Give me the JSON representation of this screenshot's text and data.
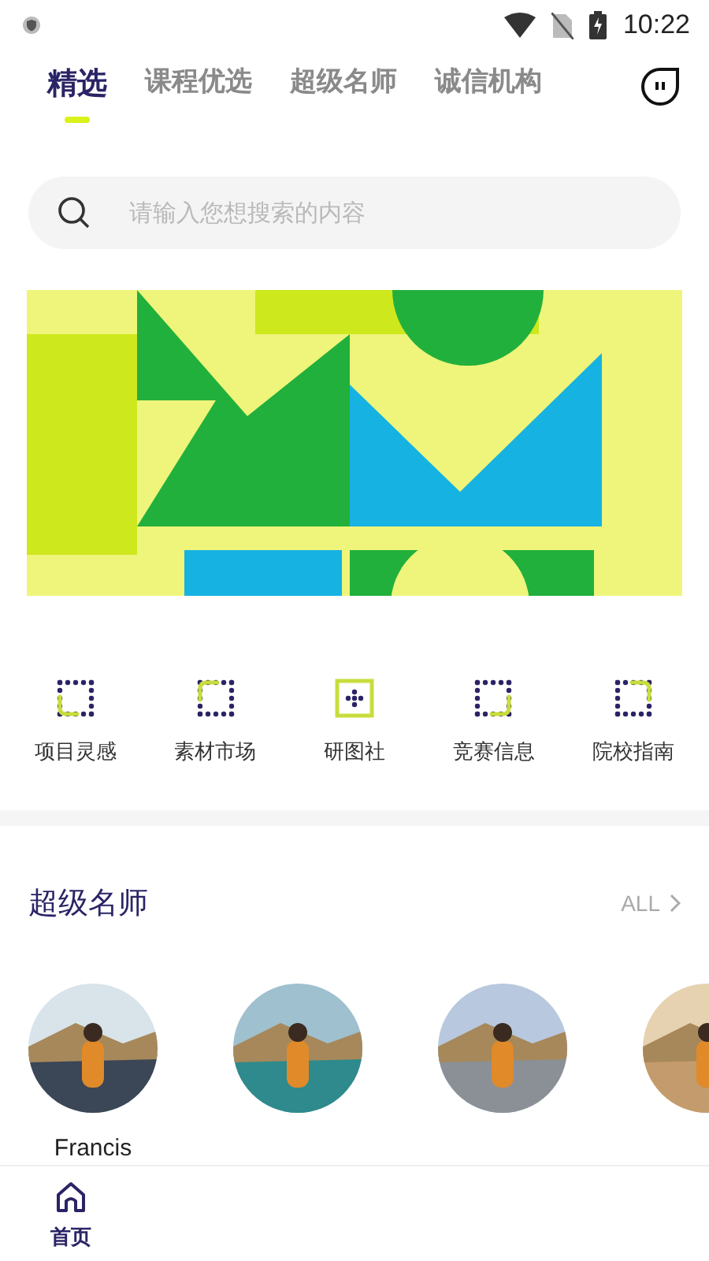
{
  "status_bar": {
    "time": "10:22"
  },
  "tabs": [
    {
      "label": "精选",
      "selected": true
    },
    {
      "label": "课程优选",
      "selected": false
    },
    {
      "label": "超级名师",
      "selected": false
    },
    {
      "label": "诚信机构",
      "selected": false
    }
  ],
  "search": {
    "placeholder": "请输入您想搜索的内容"
  },
  "banner": {
    "kind": "picture"
  },
  "shortcuts": [
    {
      "label": "项目灵感",
      "kind": "corner-bottom-left"
    },
    {
      "label": "素材市场",
      "kind": "corner-top-left"
    },
    {
      "label": "研图社",
      "kind": "square"
    },
    {
      "label": "竞赛信息",
      "kind": "corner-bottom-right"
    },
    {
      "label": "院校指南",
      "kind": "corner-top-right"
    }
  ],
  "teachers_section": {
    "title": "超级名师",
    "more": "ALL",
    "teachers": [
      {
        "kind": "picture",
        "name": "Francis"
      },
      {
        "kind": "picture"
      },
      {
        "kind": "picture"
      },
      {
        "kind": "picture"
      }
    ]
  },
  "bottom_nav": [
    {
      "label": "首页",
      "selected": true
    }
  ]
}
